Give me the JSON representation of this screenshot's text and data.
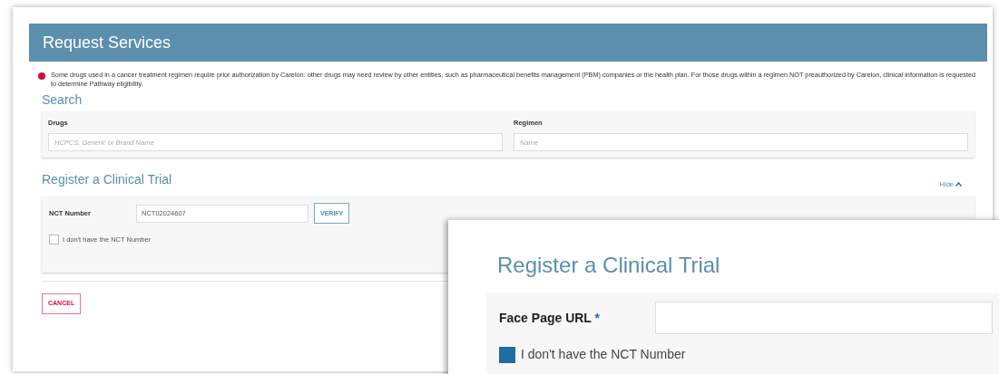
{
  "header": {
    "title": "Request Services"
  },
  "notice": "Some drugs used in a cancer treatment regimen require prior authorization by Carelon: other drugs may need review by other entities, such as pharmaceutical benefits management (PBM) companies or the health plan. For those drugs within a regimen NOT preauthorized by Carelon, clinical information is requested to determine Pathway eligibility.",
  "search": {
    "title": "Search",
    "fields": [
      {
        "label": "Drugs",
        "placeholder": "HCPCS, Generic or Brand Name"
      },
      {
        "label": "Regimen",
        "placeholder": "Name"
      }
    ]
  },
  "clinical_trial": {
    "title": "Register a Clinical Trial",
    "toggle": "Hide",
    "nct_label": "NCT Number",
    "nct_value": "NCT02024607",
    "verify": "VERIFY",
    "no_nct": {
      "label": "I don't have the NCT Number",
      "checked": false
    }
  },
  "cancel": "CANCEL",
  "zoom_inset": {
    "title": "Register a Clinical Trial",
    "face_page_label": "Face Page URL",
    "required_mark": "*",
    "no_nct": {
      "label": "I don't have the NCT Number",
      "checked": true
    }
  }
}
